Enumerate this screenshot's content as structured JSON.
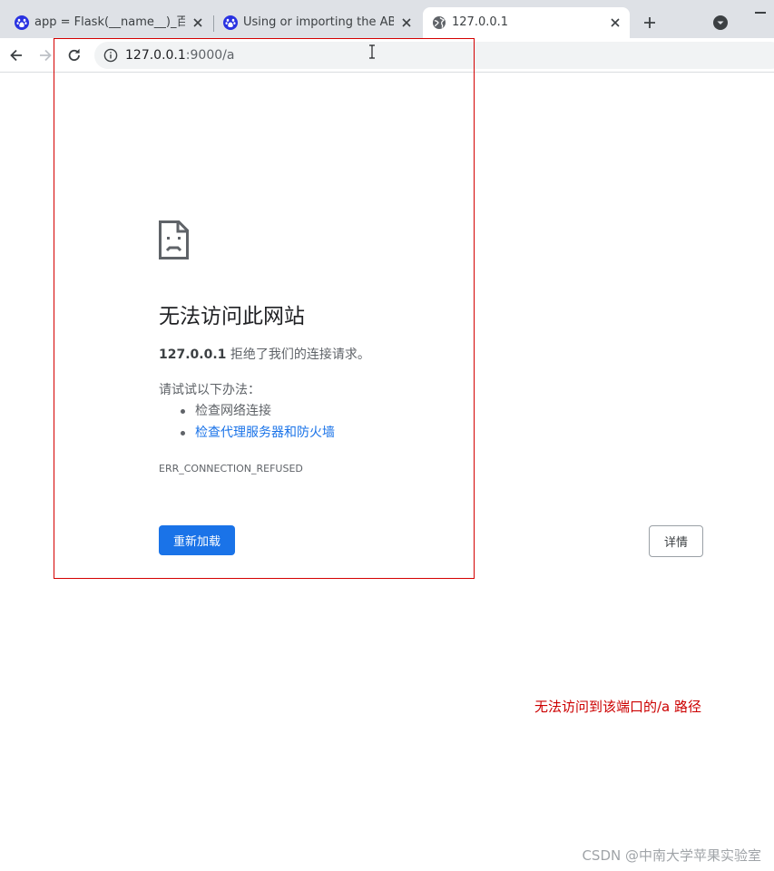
{
  "tabs": [
    {
      "title": "app = Flask(__name__)_百度搜",
      "icon": "baidu-paw-icon",
      "active": false
    },
    {
      "title": "Using or importing the ABCs",
      "icon": "baidu-paw-icon",
      "active": false
    },
    {
      "title": "127.0.0.1",
      "icon": "globe-icon",
      "active": true
    }
  ],
  "address_bar": {
    "url_host": "127.0.0.1",
    "url_rest": ":9000/a"
  },
  "error_page": {
    "title": "无法访问此网站",
    "summary_host": "127.0.0.1",
    "summary_text": " 拒绝了我们的连接请求。",
    "try_label": "请试试以下办法：",
    "suggestions": [
      {
        "text": "检查网络连接",
        "link": false
      },
      {
        "text": "检查代理服务器和防火墙",
        "link": true
      }
    ],
    "error_code": "ERR_CONNECTION_REFUSED",
    "reload_label": "重新加载",
    "details_label": "详情"
  },
  "annotation": {
    "text": "无法访问到该端口的/a 路径",
    "color": "#cc0000"
  },
  "watermark": "CSDN @中南大学苹果实验室",
  "colors": {
    "accent": "#1a73e8",
    "annotation_box": "#d40000"
  }
}
